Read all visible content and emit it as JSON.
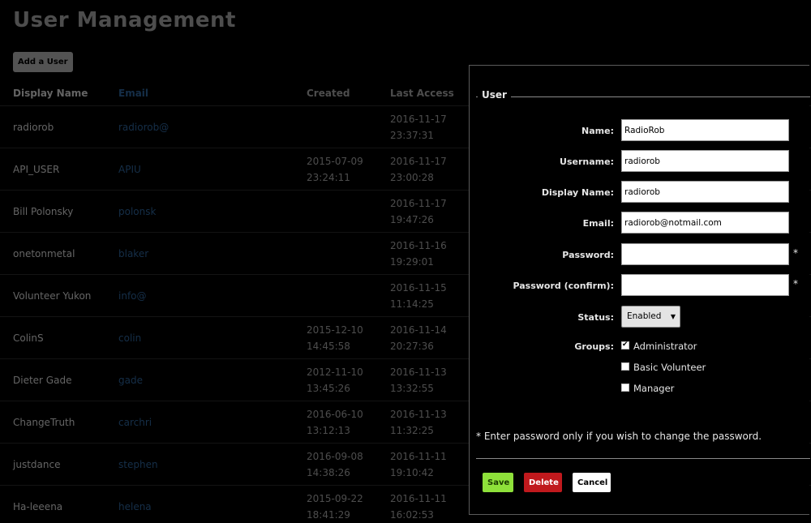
{
  "page": {
    "title": "User Management",
    "add_user_label": "Add a User"
  },
  "table": {
    "headers": {
      "display_name": "Display Name",
      "email": "Email",
      "created": "Created",
      "last_access": "Last Access"
    },
    "rows": [
      {
        "name": "radiorob",
        "email": "radiorob@",
        "created_date": "",
        "created_time": "",
        "access_date": "2016-11-17",
        "access_time": "23:37:31"
      },
      {
        "name": "API_USER",
        "email": "APIU",
        "created_date": "2015-07-09",
        "created_time": "23:24:11",
        "access_date": "2016-11-17",
        "access_time": "23:00:28"
      },
      {
        "name": "Bill Polonsky",
        "email": "polonsk",
        "created_date": "",
        "created_time": "",
        "access_date": "2016-11-17",
        "access_time": "19:47:26"
      },
      {
        "name": "onetonmetal",
        "email": "blaker",
        "created_date": "",
        "created_time": "",
        "access_date": "2016-11-16",
        "access_time": "19:29:01"
      },
      {
        "name": "Volunteer Yukon",
        "email": "info@",
        "created_date": "",
        "created_time": "",
        "access_date": "2016-11-15",
        "access_time": "11:14:25"
      },
      {
        "name": "ColinS",
        "email": "colin",
        "created_date": "2015-12-10",
        "created_time": "14:45:58",
        "access_date": "2016-11-14",
        "access_time": "20:27:36"
      },
      {
        "name": "Dieter Gade",
        "email": "gade",
        "created_date": "2012-11-10",
        "created_time": "13:45:26",
        "access_date": "2016-11-13",
        "access_time": "13:32:55"
      },
      {
        "name": "ChangeTruth",
        "email": "carchri",
        "created_date": "2016-06-10",
        "created_time": "13:12:13",
        "access_date": "2016-11-13",
        "access_time": "11:32:25"
      },
      {
        "name": "justdance",
        "email": "stephen",
        "created_date": "2016-09-08",
        "created_time": "14:38:26",
        "access_date": "2016-11-11",
        "access_time": "19:10:42"
      },
      {
        "name": "Ha-leeena",
        "email": "helena",
        "created_date": "2015-09-22",
        "created_time": "18:41:29",
        "access_date": "2016-11-11",
        "access_time": "16:02:53"
      }
    ]
  },
  "modal": {
    "legend": "User",
    "fields": {
      "name": {
        "label": "Name:",
        "value": "RadioRob"
      },
      "username": {
        "label": "Username:",
        "value": "radiorob"
      },
      "display_name": {
        "label": "Display Name:",
        "value": "radiorob"
      },
      "email": {
        "label": "Email:",
        "value": "radiorob@notmail.com"
      },
      "password": {
        "label": "Password:",
        "value": ""
      },
      "password_confirm": {
        "label": "Password (confirm):",
        "value": ""
      }
    },
    "required_mark": "*",
    "status": {
      "label": "Status:",
      "value": "Enabled",
      "chevron": "▼"
    },
    "groups": {
      "label": "Groups:",
      "items": [
        {
          "label": "Administrator",
          "checked": true
        },
        {
          "label": "Basic Volunteer",
          "checked": false
        },
        {
          "label": "Manager",
          "checked": false
        }
      ],
      "check_glyph": "✔"
    },
    "note": "* Enter password only if you wish to change the password.",
    "buttons": {
      "save": "Save",
      "delete": "Delete",
      "cancel": "Cancel"
    }
  },
  "colors": {
    "link": "#2a5d8f",
    "save": "#8ee03a",
    "delete": "#c0191d"
  }
}
